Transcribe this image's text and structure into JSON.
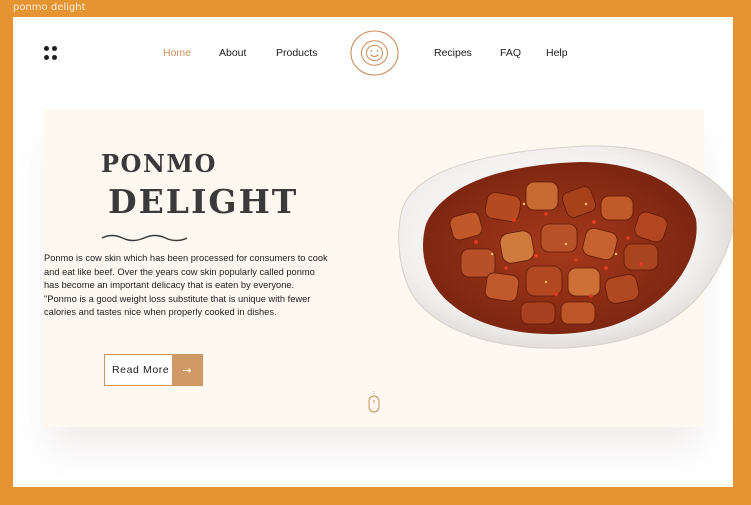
{
  "window": {
    "title": "ponmo delight"
  },
  "nav": {
    "items": [
      {
        "label": "Home",
        "active": true
      },
      {
        "label": "About",
        "active": false
      },
      {
        "label": "Products",
        "active": false
      },
      {
        "label": "Recipes",
        "active": false
      },
      {
        "label": "FAQ",
        "active": false
      },
      {
        "label": "Help",
        "active": false
      }
    ],
    "logo_icon": "smiley-icon",
    "menu_icon": "grid-dots-icon"
  },
  "hero": {
    "title_line1": "PONMO",
    "title_line2": "DELIGHT",
    "description_lines": [
      "Ponmo is cow skin which has been processed for consumers to cook",
      " and eat like beef. Over the years cow skin popularly called ponmo",
      "has become an important delicacy that is eaten by everyone.",
      " \"Ponmo is a good weight loss substitute that is unique with fewer",
      " calories and tastes nice when properly cooked in dishes."
    ],
    "button_label": "Read More",
    "button_arrow": "→",
    "scroll_icon": "mouse-scroll-icon"
  },
  "colors": {
    "frame": "#e69432",
    "accent": "#c98f5a",
    "button_fill": "#cf9a66",
    "hero_bg": "#fff8f1",
    "title": "#3a3a3a"
  }
}
